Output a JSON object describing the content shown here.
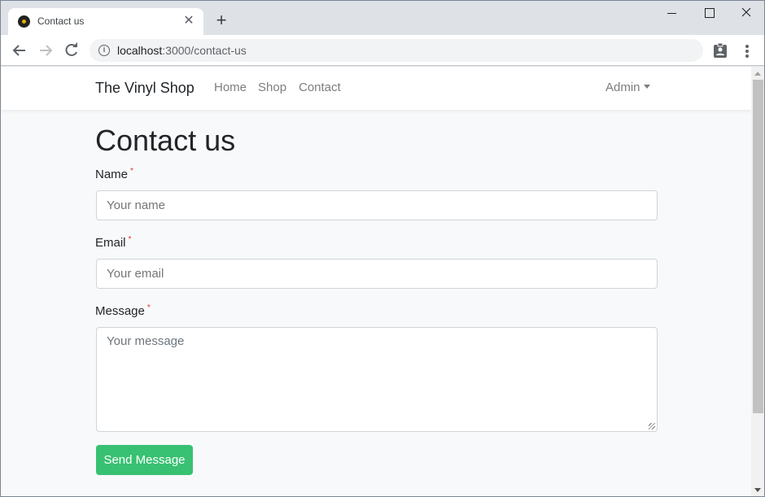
{
  "browser": {
    "tab_title": "Contact us",
    "url_host": "localhost",
    "url_rest": ":3000/contact-us",
    "tab_close_glyph": "✕",
    "new_tab_glyph": "+",
    "info_glyph": "i"
  },
  "navbar": {
    "brand": "The Vinyl Shop",
    "links": [
      {
        "label": "Home"
      },
      {
        "label": "Shop"
      },
      {
        "label": "Contact"
      }
    ],
    "admin_label": "Admin"
  },
  "page": {
    "title": "Contact us",
    "required_marker": "*",
    "fields": {
      "name": {
        "label": "Name",
        "placeholder": "Your name",
        "value": ""
      },
      "email": {
        "label": "Email",
        "placeholder": "Your email",
        "value": ""
      },
      "message": {
        "label": "Message",
        "placeholder": "Your message",
        "value": ""
      }
    },
    "submit_label": "Send Message"
  },
  "colors": {
    "accent_success": "#38c172",
    "required": "#e3342f",
    "text": "#212529",
    "nav_link": "#7d7d7d"
  }
}
